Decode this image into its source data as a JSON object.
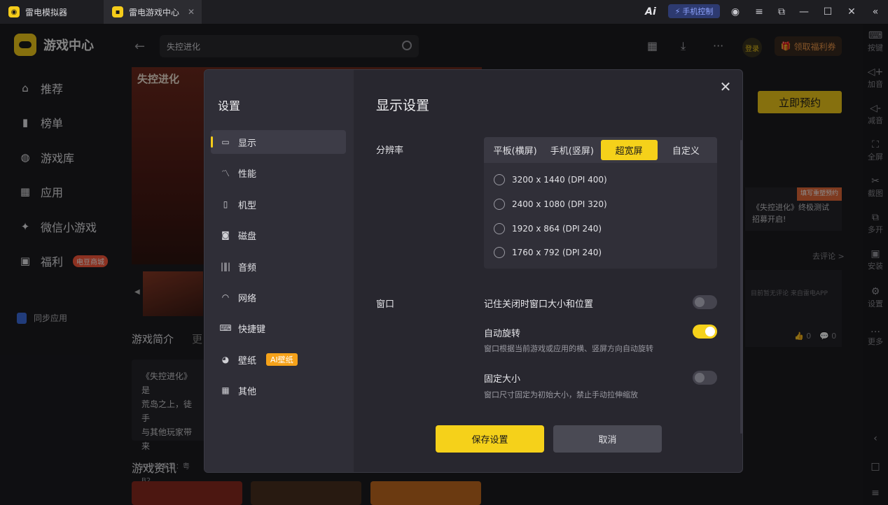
{
  "titlebar": {
    "tabs": [
      {
        "label": "雷电模拟器"
      },
      {
        "label": "雷电游戏中心"
      }
    ],
    "phone_control": "手机控制",
    "ai_label": "Ai"
  },
  "app": {
    "brand": "游戏中心",
    "nav": [
      {
        "label": "推荐",
        "icon": "home-icon"
      },
      {
        "label": "榜单",
        "icon": "chart-icon"
      },
      {
        "label": "游戏库",
        "icon": "gamepad-icon"
      },
      {
        "label": "应用",
        "icon": "apps-icon"
      },
      {
        "label": "微信小游戏",
        "icon": "wechat-game-icon"
      },
      {
        "label": "福利",
        "icon": "gift-icon",
        "badge": "电豆商城"
      }
    ],
    "sync": "同步应用",
    "search_value": "失控进化",
    "login": "登录",
    "welfare": "领取福利券",
    "hero_title": "失控进化",
    "tab_intro": "游戏简介",
    "tab_more": "更",
    "intro_lines": [
      "《失控进化》是",
      "荒岛之上，徒手",
      "与其他玩家带来"
    ],
    "intro_footer": "APP备案号：粤B2",
    "news_title": "游戏资讯",
    "reserve": "立即预约",
    "notice_tag": "填写重塑预约",
    "notice_text": "《失控进化》终极测试招募开启!",
    "goto_comment": "去评论 >",
    "comment_hint": "目前暂无评论 来自雷电APP",
    "likes": "0",
    "comments": "0"
  },
  "right_toolbar": [
    {
      "label": "按键",
      "icon": "keyboard-icon"
    },
    {
      "label": "加音",
      "icon": "volume-up-icon"
    },
    {
      "label": "减音",
      "icon": "volume-down-icon"
    },
    {
      "label": "全屏",
      "icon": "fullscreen-icon"
    },
    {
      "label": "截图",
      "icon": "scissors-icon"
    },
    {
      "label": "多开",
      "icon": "multi-instance-icon"
    },
    {
      "label": "安装",
      "icon": "apk-install-icon"
    },
    {
      "label": "设置",
      "icon": "gear-icon"
    },
    {
      "label": "更多",
      "icon": "more-icon"
    }
  ],
  "dialog": {
    "title": "设置",
    "section_title": "显示设置",
    "menu": [
      {
        "label": "显示",
        "icon": "monitor-icon",
        "active": true
      },
      {
        "label": "性能",
        "icon": "performance-icon"
      },
      {
        "label": "机型",
        "icon": "phone-icon"
      },
      {
        "label": "磁盘",
        "icon": "disk-icon"
      },
      {
        "label": "音频",
        "icon": "audio-icon"
      },
      {
        "label": "网络",
        "icon": "wifi-icon"
      },
      {
        "label": "快捷键",
        "icon": "keyboard-icon"
      },
      {
        "label": "壁纸",
        "icon": "palette-icon",
        "badge": "AI壁纸"
      },
      {
        "label": "其他",
        "icon": "grid-icon"
      }
    ],
    "resolution": {
      "label": "分辨率",
      "tabs": [
        "平板(横屏)",
        "手机(竖屏)",
        "超宽屏",
        "自定义"
      ],
      "selected_tab": "超宽屏",
      "options": [
        "3200 x 1440  (DPI 400)",
        "2400 x 1080  (DPI 320)",
        "1920 x 864  (DPI 240)",
        "1760 x 792  (DPI 240)"
      ]
    },
    "window": {
      "label": "窗口",
      "options": [
        {
          "title": "记住关闭时窗口大小和位置",
          "desc": "",
          "on": false
        },
        {
          "title": "自动旋转",
          "desc": "窗口根据当前游戏或应用的横、竖屏方向自动旋转",
          "on": true
        },
        {
          "title": "固定大小",
          "desc": "窗口尺寸固定为初始大小，禁止手动拉伸缩放",
          "on": false
        }
      ]
    },
    "save": "保存设置",
    "cancel": "取消"
  },
  "colors": {
    "accent": "#f5d11a",
    "dialog_bg": "#28272f"
  }
}
